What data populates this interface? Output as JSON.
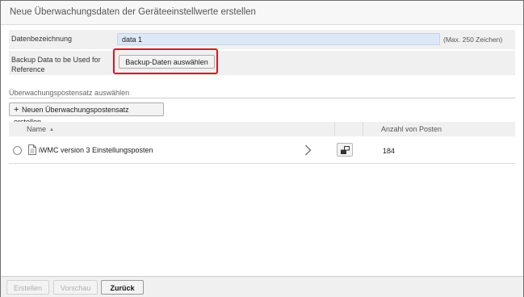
{
  "dialog": {
    "title": "Neue Überwachungsdaten der Geräteeinstellwerte erstellen"
  },
  "form": {
    "name_label": "Datenbezeichnung",
    "name_value": "data 1",
    "name_hint": "(Max. 250 Zeichen)",
    "backup_label": "Backup Data to be Used for Reference",
    "backup_button": "Backup-Daten auswählen"
  },
  "section": {
    "label": "Überwachungspostensatz auswählen",
    "new_button": "Neuen Überwachungspostensatz erstellen",
    "plus_icon": "+"
  },
  "table": {
    "columns": [
      "Name",
      "Anzahl von Posten"
    ],
    "sort_indicator": "▲",
    "rows": [
      {
        "name": "iWMC version 3 Einstellungsposten",
        "count": "184"
      }
    ]
  },
  "footer": {
    "create": "Erstellen",
    "preview": "Vorschau",
    "back": "Zurück"
  },
  "colors": {
    "highlight": "#e0141e",
    "input_bg": "#dde8f7"
  }
}
